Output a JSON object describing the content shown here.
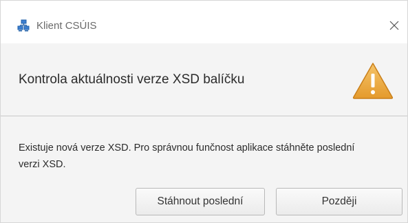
{
  "window": {
    "title": "Klient CSÚIS",
    "app_icon": "network-computers-icon",
    "close_icon": "close-icon"
  },
  "header": {
    "text": "Kontrola aktuálnosti verze XSD balíčku",
    "icon": "warning-icon",
    "icon_color": "#e8a33a"
  },
  "body": {
    "message": "Existuje nová verze XSD. Pro správnou funčnost aplikace stáhněte poslední verzi XSD."
  },
  "buttons": {
    "download_label": "Stáhnout poslední",
    "later_label": "Později"
  }
}
